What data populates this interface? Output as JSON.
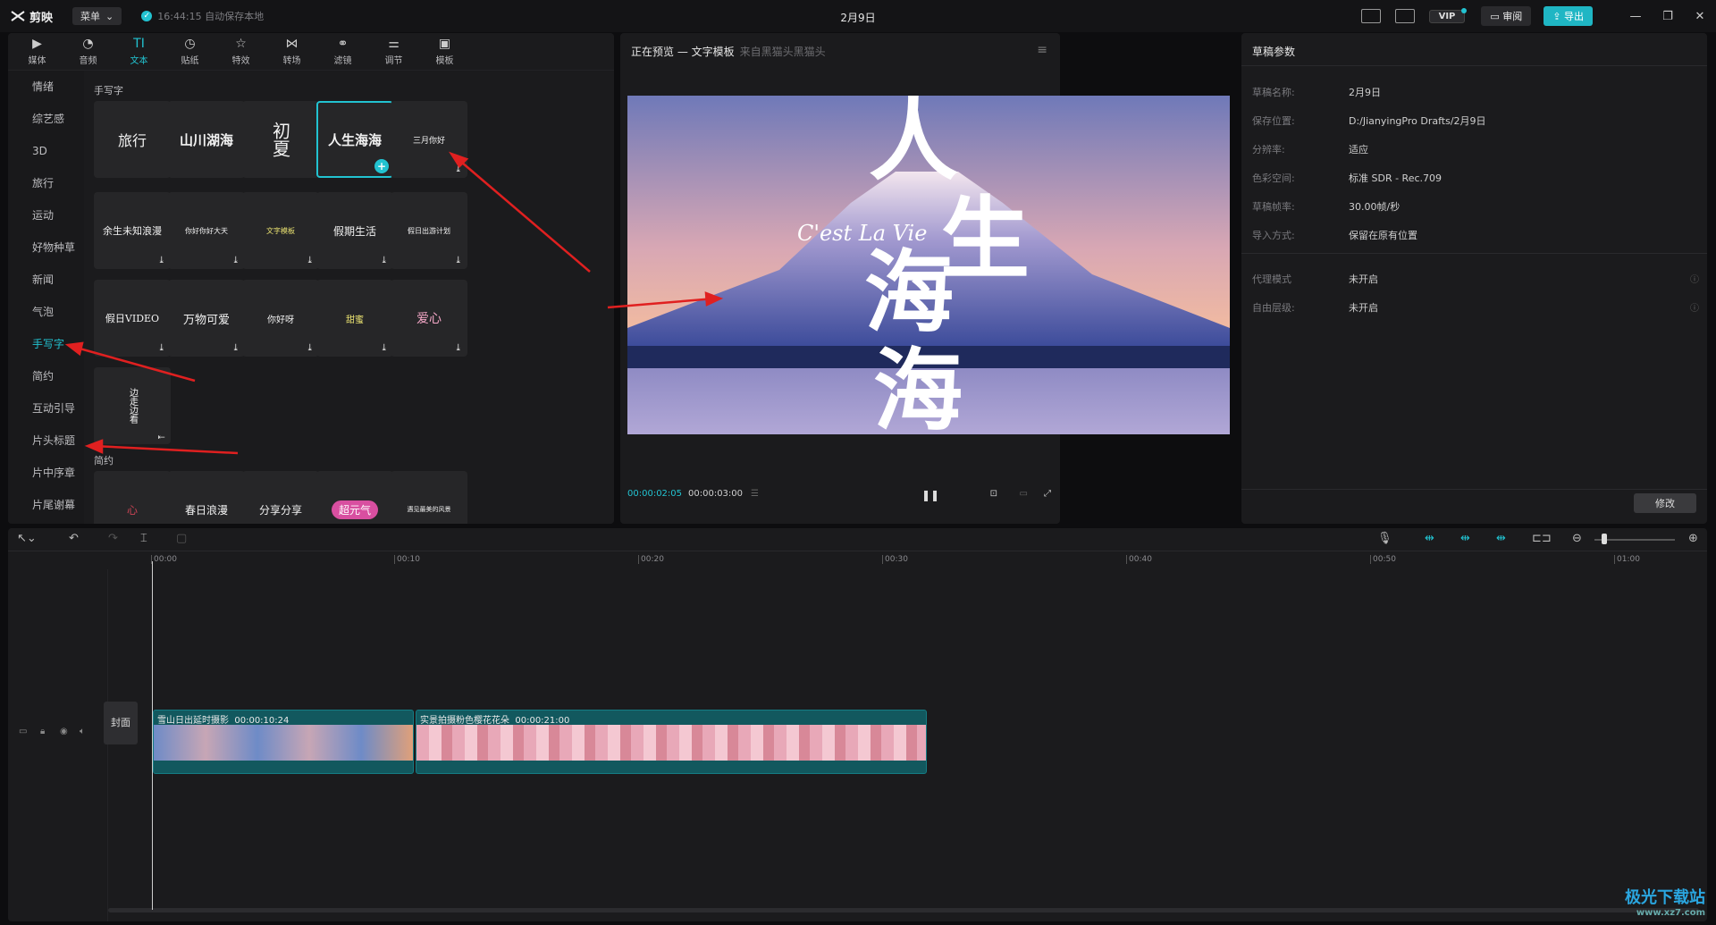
{
  "app": {
    "name": "剪映",
    "menu_label": "菜单",
    "autosave": "16:44:15 自动保存本地",
    "title": "2月9日",
    "vip": "VIP",
    "review": "审阅",
    "export": "导出"
  },
  "tabs": [
    {
      "label": "媒体",
      "icon": "▶"
    },
    {
      "label": "音频",
      "icon": "◔"
    },
    {
      "label": "文本",
      "icon": "TI"
    },
    {
      "label": "贴纸",
      "icon": "◷"
    },
    {
      "label": "特效",
      "icon": "☆"
    },
    {
      "label": "转场",
      "icon": "⋈"
    },
    {
      "label": "滤镜",
      "icon": "⚭"
    },
    {
      "label": "调节",
      "icon": "⚌"
    },
    {
      "label": "模板",
      "icon": "▣"
    }
  ],
  "side": [
    "情绪",
    "综艺感",
    "3D",
    "旅行",
    "运动",
    "好物种草",
    "新闻",
    "气泡",
    "手写字",
    "简约",
    "互动引导",
    "片头标题",
    "片中序章",
    "片尾谢幕"
  ],
  "sections": {
    "handwriting": "手写字",
    "simple": "简约"
  },
  "cards": [
    "旅行",
    "山川湖海",
    "初夏",
    "人生海海",
    "三月你好",
    "余生未知浪漫",
    "你好你好大天",
    "文字模板",
    "假期生活",
    "假日出游计划",
    "假日VIDEO",
    "万物可爱",
    "你好呀",
    "甜蜜",
    "爱心",
    "边走边看"
  ],
  "cards2": [
    "心",
    "春日浪漫",
    "分享分享",
    "超元气",
    "遇见最美的风景"
  ],
  "preview": {
    "title": "正在预览 — 文字模板",
    "source": "来自黑猫头黑猫头",
    "big_text": [
      "人",
      "生",
      "海",
      "海"
    ],
    "script_text": "C'est La Vie",
    "time_current": "00:00:02:05",
    "time_total": "00:00:03:00"
  },
  "params": {
    "title": "草稿参数",
    "rows": [
      {
        "k": "草稿名称:",
        "v": "2月9日"
      },
      {
        "k": "保存位置:",
        "v": "D:/JianyingPro Drafts/2月9日"
      },
      {
        "k": "分辨率:",
        "v": "适应"
      },
      {
        "k": "色彩空间:",
        "v": "标准 SDR - Rec.709"
      },
      {
        "k": "草稿帧率:",
        "v": "30.00帧/秒"
      },
      {
        "k": "导入方式:",
        "v": "保留在原有位置"
      }
    ],
    "rows2": [
      {
        "k": "代理模式",
        "v": "未开启"
      },
      {
        "k": "自由层级:",
        "v": "未开启"
      }
    ],
    "modify": "修改"
  },
  "timeline": {
    "ticks": [
      "00:00",
      "00:10",
      "00:20",
      "00:30",
      "00:40",
      "00:50",
      "01:00"
    ],
    "cover": "封面",
    "clips": [
      {
        "name": "雪山日出延时摄影",
        "dur": "00:00:10:24"
      },
      {
        "name": "实景拍摄粉色樱花花朵",
        "dur": "00:00:21:00"
      }
    ]
  },
  "watermark": {
    "title": "极光下载站",
    "url": "www.xz7.com"
  }
}
